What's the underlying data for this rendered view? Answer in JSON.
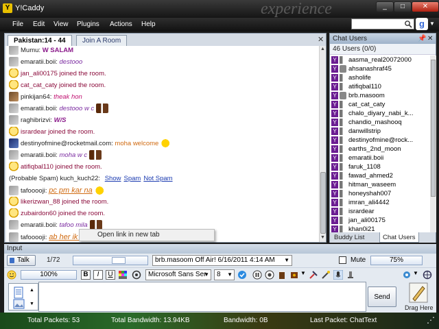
{
  "window": {
    "title": "Y!Caddy",
    "watermark": "experience",
    "minimize": "_",
    "maximize": "□",
    "close": "✕"
  },
  "menu": [
    "File",
    "Edit",
    "View",
    "Plugins",
    "Actions",
    "Help"
  ],
  "search": {
    "value": "",
    "placeholder": ""
  },
  "tabs": [
    {
      "label": "Pakistan:14 - 44",
      "active": true
    },
    {
      "label": "Join A Room",
      "active": false
    }
  ],
  "messages": [
    {
      "avatar": "photo",
      "nick": "Mumu:",
      "text": "W SALAM",
      "style": "color:#8a1a8a;font-weight:bold"
    },
    {
      "avatar": "photo",
      "nick": "emaratii.boii:",
      "text": "destooo",
      "style": "color:#7a2aa0;font-style:italic"
    },
    {
      "avatar": "smile",
      "nick": "",
      "text": "jan_ali00175 joined the room.",
      "style": "color:#8a0a3a"
    },
    {
      "avatar": "smile",
      "nick": "",
      "text": "cat_cat_caty joined the room.",
      "style": "color:#8a0a3a"
    },
    {
      "avatar": "photo2",
      "nick": "pinkijan64:",
      "text": "theak hon",
      "style": "color:#c01070;font-style:italic"
    },
    {
      "avatar": "photo",
      "nick": "emaratii.boii:",
      "text": "destooo w c",
      "style": "color:#7a2aa0;font-style:italic",
      "emo": true
    },
    {
      "avatar": "photo",
      "nick": "raghibrizvi:",
      "text": "W/S",
      "style": "color:#8a1a8a;font-weight:bold;font-style:italic"
    },
    {
      "avatar": "smile",
      "nick": "",
      "text": "isrardear joined the room.",
      "style": "color:#8a0a3a"
    },
    {
      "avatar": "blue",
      "nick": "destinyofmine@rocketmail.com:",
      "text": "moha welcome",
      "style": "color:#d06a10",
      "emo": true
    },
    {
      "avatar": "photo",
      "nick": "emaratii.boii:",
      "text": "moha w c",
      "style": "color:#7a2aa0;font-style:italic",
      "emo": true
    },
    {
      "avatar": "smile",
      "nick": "",
      "text": "atifiqbal110 joined the room.",
      "style": "color:#8a0a3a"
    },
    {
      "avatar": "none",
      "nick": "(Probable Spam) kuch_kuch22:",
      "text": "",
      "style": "",
      "spam": true
    },
    {
      "avatar": "photo",
      "nick": "tafooooji:",
      "text": "pc pm kar na",
      "style": "color:#d06a10;font-style:italic;text-decoration:underline;font-size:11px",
      "emo": true
    },
    {
      "avatar": "smile",
      "nick": "",
      "text": "likerizwan_88 joined the room.",
      "style": "color:#8a0a3a"
    },
    {
      "avatar": "smile",
      "nick": "",
      "text": "zubairdon60 joined the room.",
      "style": "color:#8a0a3a"
    },
    {
      "avatar": "photo",
      "nick": "emaratii.boii:",
      "text": "tafoo mila",
      "style": "color:#7a2aa0;font-style:italic",
      "emo": true
    },
    {
      "avatar": "photo",
      "nick": "tafooooji:",
      "text": "ab her ik ki id yahoo c ha",
      "style": "color:#d06a10;font-style:italic;text-decoration:underline;font-size:11px",
      "emo": true
    }
  ],
  "spam_links": {
    "show": "Show",
    "spam": "Spam",
    "not_spam": "Not Spam"
  },
  "context_menu": {
    "item": "Open link in new tab"
  },
  "chat_users": {
    "title": "Chat Users",
    "count": "46 Users (0/0)",
    "list": [
      "aasma_real20072000",
      "ahsanashraf45",
      "asholife",
      "atifiqbal110",
      "brb.masoom",
      "cat_cat_caty",
      "chalo_diyary_nabi_k...",
      "chandio_mashooq",
      "danwillstrip",
      "destinyofmine@rock...",
      "earths_2nd_moon",
      "emaratii.boii",
      "faruk_1108",
      "fawad_ahmed2",
      "hitman_waseem",
      "honeyshah007",
      "imran_ali4442",
      "isrardear",
      "jan_ali00175",
      "khan0i21"
    ],
    "tab_buddy": "Buddy List",
    "tab_chat": "Chat Users"
  },
  "input": {
    "title": "Input",
    "talk": "Talk",
    "page": "1/72",
    "status_message": "brb.masoom Off Air! 6/16/2011 4:14 AM",
    "mute": "Mute",
    "volume": "75%",
    "zoom": "100%",
    "font": "Microsoft Sans Ser",
    "size": "8",
    "compose": "",
    "send": "Send",
    "drag": "Drag Here"
  },
  "status": {
    "packets": "Total Packets: 53",
    "bandwidth": "Total Bandwidth: 13.94KB",
    "rate": "Bandwidth: 0B",
    "last": "Last Packet: ChatText"
  }
}
